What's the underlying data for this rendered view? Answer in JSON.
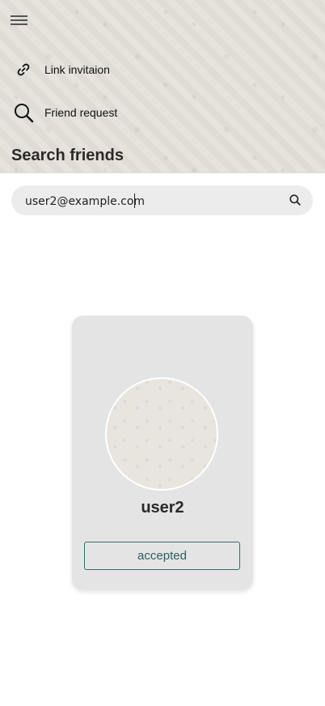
{
  "header": {
    "menu_icon": "hamburger-menu-icon",
    "nav": [
      {
        "label": "Link invitaion",
        "icon": "link-icon"
      },
      {
        "label": "Friend request",
        "icon": "search-icon"
      }
    ],
    "section_title": "Search friends"
  },
  "search": {
    "value": "user2@example.com",
    "icon": "search-icon"
  },
  "result_card": {
    "username": "user2",
    "status_label": "accepted"
  },
  "colors": {
    "header_bg": "#e6e3dc",
    "search_bg": "#ececec",
    "card_bg": "#e4e4e4",
    "status_accent": "#2e5f5f"
  }
}
